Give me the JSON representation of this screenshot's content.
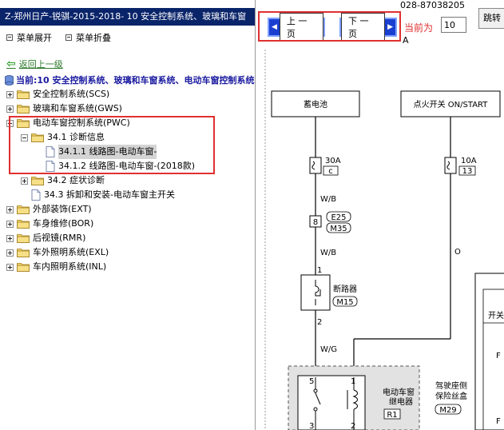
{
  "left": {
    "title": "Z-郑州日产-锐骐-2015-2018- 10 安全控制系统、玻璃和车窗",
    "expand_all": "菜单展开",
    "collapse_all": "菜单折叠",
    "back": "返回上一级",
    "current": "当前:10 安全控制系统、玻璃和车窗系统、电动车窗控制系统",
    "tree": [
      {
        "label": "安全控制系统(SCS)",
        "type": "folder",
        "level": 0,
        "toggle": "plus"
      },
      {
        "label": "玻璃和车窗系统(GWS)",
        "type": "folder",
        "level": 0,
        "toggle": "plus"
      },
      {
        "label": "电动车窗控制系统(PWC)",
        "type": "folder",
        "level": 0,
        "toggle": "minus"
      },
      {
        "label": "34.1 诊断信息",
        "type": "folder",
        "level": 1,
        "toggle": "minus"
      },
      {
        "label": "34.1.1 线路图-电动车窗-",
        "type": "doc",
        "level": 2,
        "selected": true
      },
      {
        "label": "34.1.2 线路图-电动车窗-(2018款)",
        "type": "doc",
        "level": 2
      },
      {
        "label": "34.2 症状诊断",
        "type": "folder",
        "level": 1,
        "toggle": "plus"
      },
      {
        "label": "34.3 拆卸和安装-电动车窗主开关",
        "type": "doc",
        "level": 1
      },
      {
        "label": "外部装饰(EXT)",
        "type": "folder",
        "level": 0,
        "toggle": "plus"
      },
      {
        "label": "车身维修(BOR)",
        "type": "folder",
        "level": 0,
        "toggle": "plus"
      },
      {
        "label": "后视镜(RMR)",
        "type": "folder",
        "level": 0,
        "toggle": "plus"
      },
      {
        "label": "车外照明系统(EXL)",
        "type": "folder",
        "level": 0,
        "toggle": "plus"
      },
      {
        "label": "车内照明系统(INL)",
        "type": "folder",
        "level": 0,
        "toggle": "plus"
      }
    ]
  },
  "toolbar": {
    "prev": "上 一 页",
    "next": "下 一 页",
    "current_label": "当前为",
    "page_value": "10",
    "jump": "跳转",
    "tel": "028-87038205",
    "a_mark": "A"
  },
  "diagram": {
    "battery": "蓄电池",
    "ignition": "点火开关 ON/START",
    "fuse_left_rating": "30A",
    "fuse_left_code": "c",
    "fuse_right_rating": "10A",
    "fuse_right_code": "13",
    "wire_wb_1": "W/B",
    "wire_wb_2": "W/B",
    "wire_wg": "W/G",
    "wire_o": "O",
    "conn_8": "8",
    "conn_e25": "E25",
    "conn_m35": "M35",
    "breaker": "断路器",
    "breaker_code": "M15",
    "pin_1": "1",
    "pin_2": "2",
    "relay_label_1": "电动车窗",
    "relay_label_2": "继电器",
    "relay_code": "R1",
    "relay_pin_5": "5",
    "relay_pin_1": "1",
    "relay_pin_3": "3",
    "relay_pin_2": "2",
    "fuse_box_label_1": "驾驶座侧",
    "fuse_box_label_2": "保险丝盒",
    "fuse_box_code": "M29",
    "switch_label": "开关",
    "f_label_1": "F",
    "f_label_2": "F"
  },
  "colors": {
    "title_bar": "#0a246a",
    "highlight": "#e03030",
    "button_blue": "#1a3fd0"
  }
}
